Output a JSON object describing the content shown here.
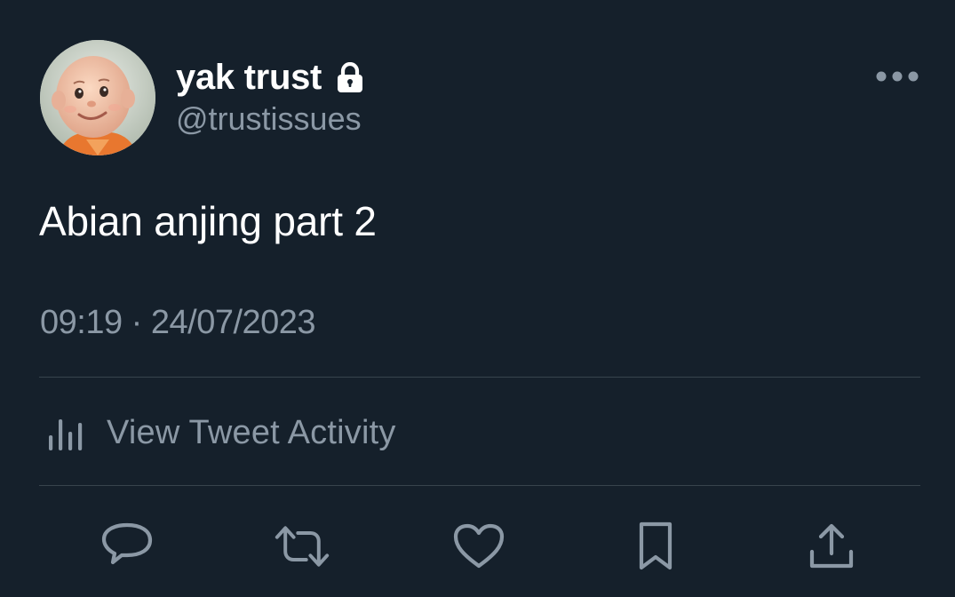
{
  "tweet": {
    "display_name": "yak trust",
    "handle": "@trustissues",
    "protected_icon": "lock-icon",
    "text": "Abian anjing part 2",
    "timestamp": "09:19 · 24/07/2023"
  },
  "activity": {
    "label": "View Tweet Activity",
    "icon": "bar-chart-icon"
  },
  "actions": [
    {
      "name": "reply",
      "icon": "reply-icon"
    },
    {
      "name": "retweet",
      "icon": "retweet-icon"
    },
    {
      "name": "like",
      "icon": "heart-icon"
    },
    {
      "name": "bookmark",
      "icon": "bookmark-icon"
    },
    {
      "name": "share",
      "icon": "share-icon"
    }
  ],
  "colors": {
    "background": "#15202b",
    "text_primary": "#ffffff",
    "text_secondary": "#8b98a5",
    "divider": "#38444d"
  }
}
